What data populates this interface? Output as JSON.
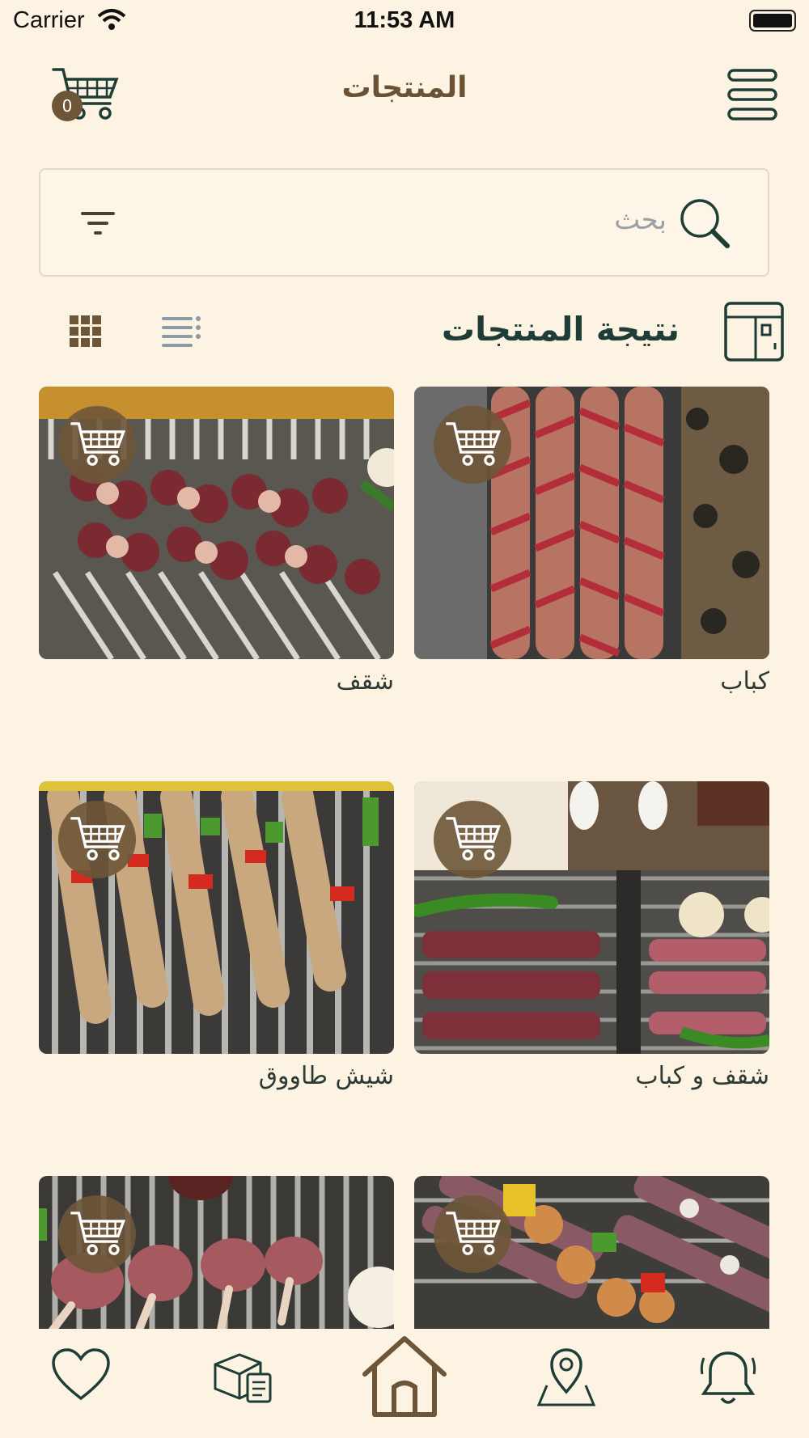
{
  "status_bar": {
    "carrier": "Carrier",
    "time": "11:53 AM"
  },
  "header": {
    "title": "المنتجات",
    "cart_count": "0"
  },
  "search": {
    "placeholder": "بحث"
  },
  "results": {
    "title": "نتيجة المنتجات"
  },
  "products": [
    {
      "name": "كباب",
      "photo": "kebab-rolls"
    },
    {
      "name": "شقف",
      "photo": "meat-cubes"
    },
    {
      "name": "شقف و كباب",
      "photo": "mixed-grill"
    },
    {
      "name": "شيش طاووق",
      "photo": "chicken-skewers"
    },
    {
      "name": "",
      "photo": "kebab-chicken-mix"
    },
    {
      "name": "",
      "photo": "lamb-chops"
    }
  ],
  "tabs": [
    {
      "icon": "bell-icon"
    },
    {
      "icon": "location-pin-icon"
    },
    {
      "icon": "home-icon"
    },
    {
      "icon": "orders-box-icon"
    },
    {
      "icon": "heart-icon"
    }
  ],
  "colors": {
    "background": "#fcf3e3",
    "accent_brown": "#6d5638",
    "dark_green": "#1d3d36"
  }
}
